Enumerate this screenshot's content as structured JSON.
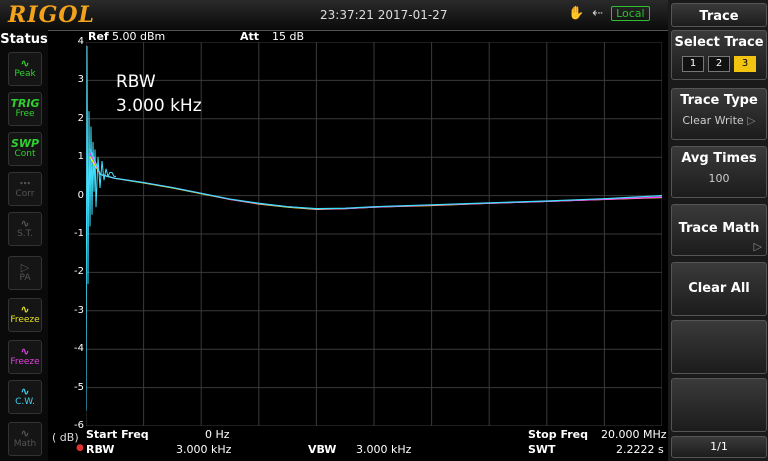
{
  "header": {
    "logo": "RIGOL",
    "datetime": "23:37:21 2017-01-27",
    "local": "Local"
  },
  "status": {
    "title": "Status",
    "buttons": [
      {
        "top": "Peak",
        "icon": "~"
      },
      {
        "top": "TRIG",
        "bottom": "Free"
      },
      {
        "top": "SWP",
        "bottom": "Cont"
      },
      {
        "bottom": "Corr"
      },
      {
        "bottom": "S.T."
      },
      {
        "bottom": "PA"
      },
      {
        "bottom": "Freeze"
      },
      {
        "bottom": "Freeze"
      },
      {
        "bottom": "C.W."
      },
      {
        "bottom": "Math"
      }
    ]
  },
  "plot_header": {
    "ref": "Ref",
    "ref_value": "5.00 dBm",
    "att": "Att",
    "att_value": "15 dB"
  },
  "annotation": {
    "line1": "RBW",
    "line2": "3.000 kHz"
  },
  "yunit": "( dB)",
  "footer": {
    "start_label": "Start Freq",
    "start_value": "0 Hz",
    "stop_label": "Stop Freq",
    "stop_value": "20.000 MHz",
    "rbw_label": "RBW",
    "rbw_value": "3.000 kHz",
    "vbw_label": "VBW",
    "vbw_value": "3.000 kHz",
    "swt_label": "SWT",
    "swt_value": "2.2222 s"
  },
  "softkeys": {
    "title": "Trace",
    "select_trace": "Select Trace",
    "traces": [
      "1",
      "2",
      "3"
    ],
    "trace_type": "Trace Type",
    "trace_type_value": "Clear Write",
    "avg_times": "Avg Times",
    "avg_times_value": "100",
    "trace_math": "Trace Math",
    "clear_all": "Clear All",
    "page": "1/1"
  },
  "chart_data": {
    "type": "line",
    "ylim": [
      -6,
      4
    ],
    "yticks": [
      "4",
      "3",
      "2",
      "1",
      "0",
      "-1",
      "-2",
      "-3",
      "-4",
      "-5",
      "-6"
    ],
    "xrange_mhz": [
      0,
      20
    ],
    "grid": true,
    "series": [
      {
        "color": "#ffff00",
        "x": [
          0.15,
          0.5,
          1,
          2,
          3,
          4,
          5,
          6,
          7,
          8,
          9,
          10,
          12,
          14,
          16,
          18,
          20
        ],
        "y": [
          1.0,
          0.55,
          0.45,
          0.33,
          0.2,
          0.05,
          -0.1,
          -0.22,
          -0.3,
          -0.36,
          -0.34,
          -0.3,
          -0.26,
          -0.2,
          -0.15,
          -0.1,
          -0.05
        ]
      },
      {
        "color": "#ff40ff",
        "x": [
          0.15,
          0.5,
          1,
          2,
          3,
          4,
          5,
          6,
          7,
          8,
          9,
          10,
          12,
          14,
          16,
          18,
          20
        ],
        "y": [
          1.1,
          0.55,
          0.45,
          0.34,
          0.21,
          0.06,
          -0.1,
          -0.21,
          -0.29,
          -0.35,
          -0.34,
          -0.3,
          -0.25,
          -0.2,
          -0.15,
          -0.1,
          -0.04
        ]
      },
      {
        "color": "#40e0ff",
        "x": [
          0.15,
          0.5,
          1,
          2,
          3,
          4,
          5,
          6,
          7,
          8,
          9,
          10,
          12,
          14,
          16,
          18,
          20
        ],
        "y": [
          1.2,
          0.55,
          0.45,
          0.34,
          0.21,
          0.06,
          -0.09,
          -0.2,
          -0.29,
          -0.34,
          -0.33,
          -0.29,
          -0.24,
          -0.19,
          -0.14,
          -0.08,
          0.0
        ]
      }
    ]
  }
}
